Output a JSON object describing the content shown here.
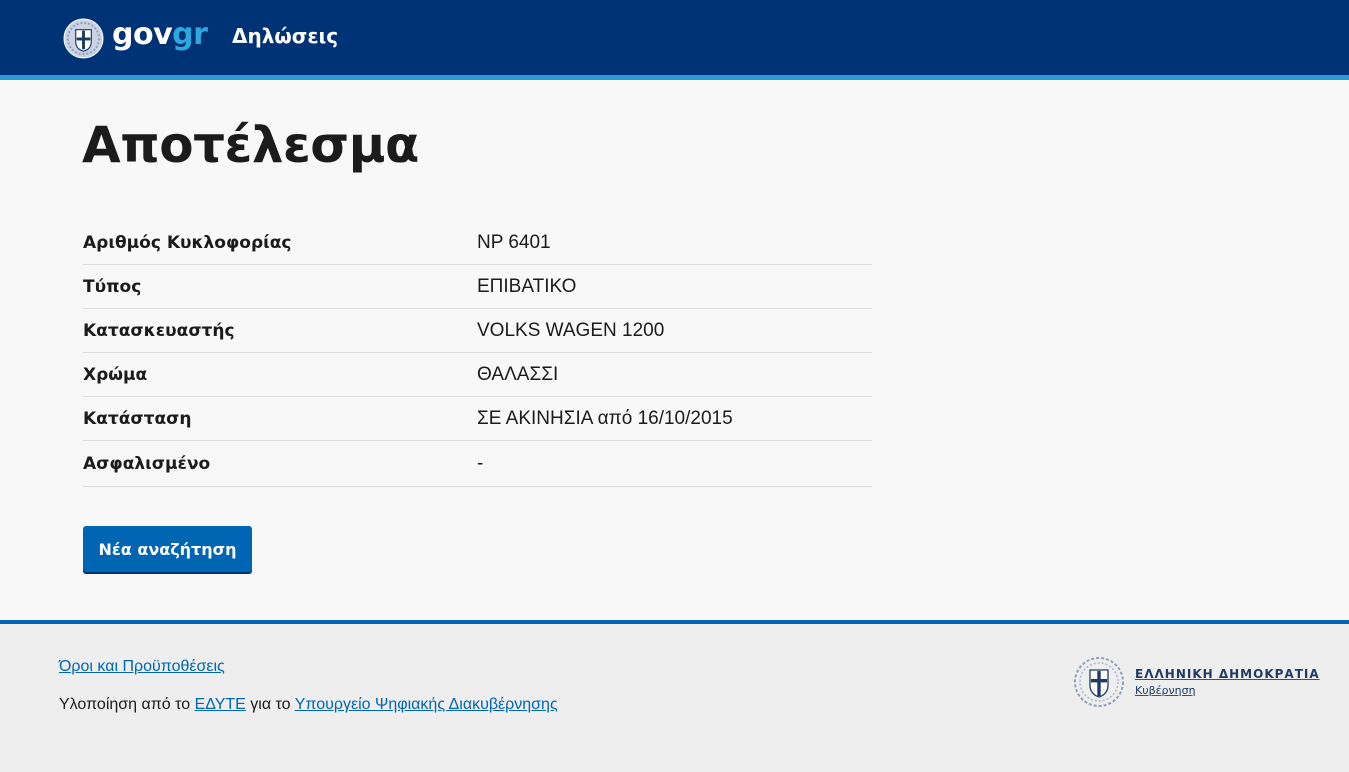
{
  "header": {
    "logo_gov": "gov",
    "logo_gr": "gr",
    "title": "Δηλώσεις"
  },
  "page": {
    "title": "Αποτέλεσμα"
  },
  "results": [
    {
      "label": "Αριθμός Κυκλοφορίας",
      "value": "ΝΡ 6401"
    },
    {
      "label": "Τύπος",
      "value": "ΕΠΙΒΑΤΙΚΟ"
    },
    {
      "label": "Κατασκευαστής",
      "value": "VOLKS WAGEN 1200"
    },
    {
      "label": "Χρώμα",
      "value": "ΘΑΛΑΣΣΙ"
    },
    {
      "label": "Κατάσταση",
      "value": "ΣΕ ΑΚΙΝΗΣΙΑ από 16/10/2015"
    },
    {
      "label": "Ασφαλισμένο",
      "value": "-"
    }
  ],
  "actions": {
    "new_search_label": "Νέα αναζήτηση"
  },
  "footer": {
    "terms_link": "Όροι και Προϋποθέσεις",
    "credits_prefix": "Υλοποίηση από το ",
    "credits_org": "ΕΔΥΤΕ",
    "credits_middle": " για το ",
    "credits_ministry": "Υπουργείο Ψηφιακής Διακυβέρνησης",
    "gov_logo_line1": "ΕΛΛΗΝΙΚΗ ΔΗΜΟΚΡΑΤΙΑ",
    "gov_logo_line2": "Κυβέρνηση"
  },
  "colors": {
    "header_bg": "#003375",
    "header_stripe": "#2a9bd8",
    "primary": "#0065b3",
    "footer_bg": "#eeeeee"
  },
  "icons": {
    "header_emblem": "greek-coat-of-arms-icon",
    "footer_emblem": "greek-coat-of-arms-icon"
  }
}
